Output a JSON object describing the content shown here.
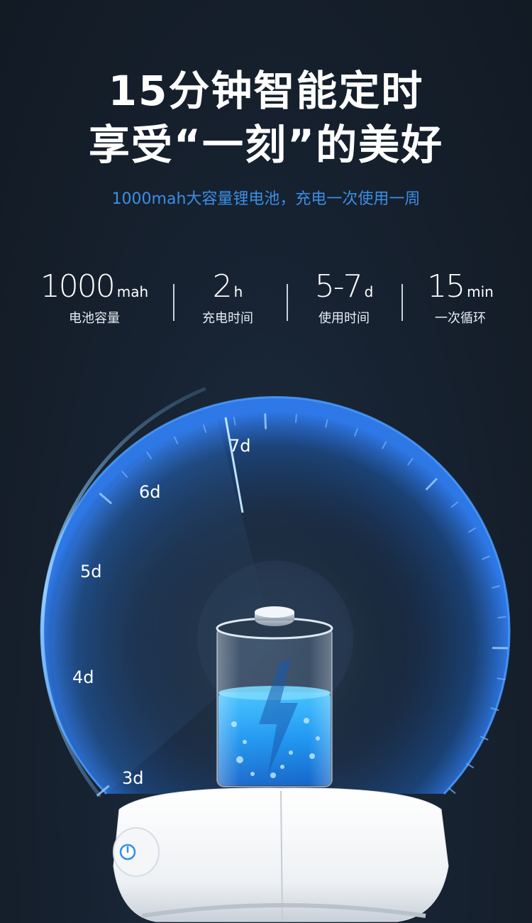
{
  "headline": {
    "line1": "15分钟智能定时",
    "line2": "享受“一刻”的美好"
  },
  "subtitle": "1000mah大容量锂电池，充电一次使用一周",
  "specs": [
    {
      "value": "1000",
      "unit": "mah",
      "label": "电池容量"
    },
    {
      "value": "2",
      "unit": "h",
      "label": "充电时间"
    },
    {
      "value": "5-7",
      "unit": "d",
      "label": "使用时间"
    },
    {
      "value": "15",
      "unit": "min",
      "label": "一次循环"
    }
  ],
  "gauge": {
    "labels": [
      "3d",
      "4d",
      "5d",
      "6d",
      "7d"
    ],
    "pointer_label": "7d"
  },
  "colors": {
    "background": "#15202c",
    "accent_blue": "#3b8fe6",
    "gauge_glow": "#1e6fe0",
    "liquid": "#1aa3ff"
  },
  "icons": {
    "battery": "battery-icon",
    "lightning": "lightning-icon",
    "power": "power-icon"
  }
}
